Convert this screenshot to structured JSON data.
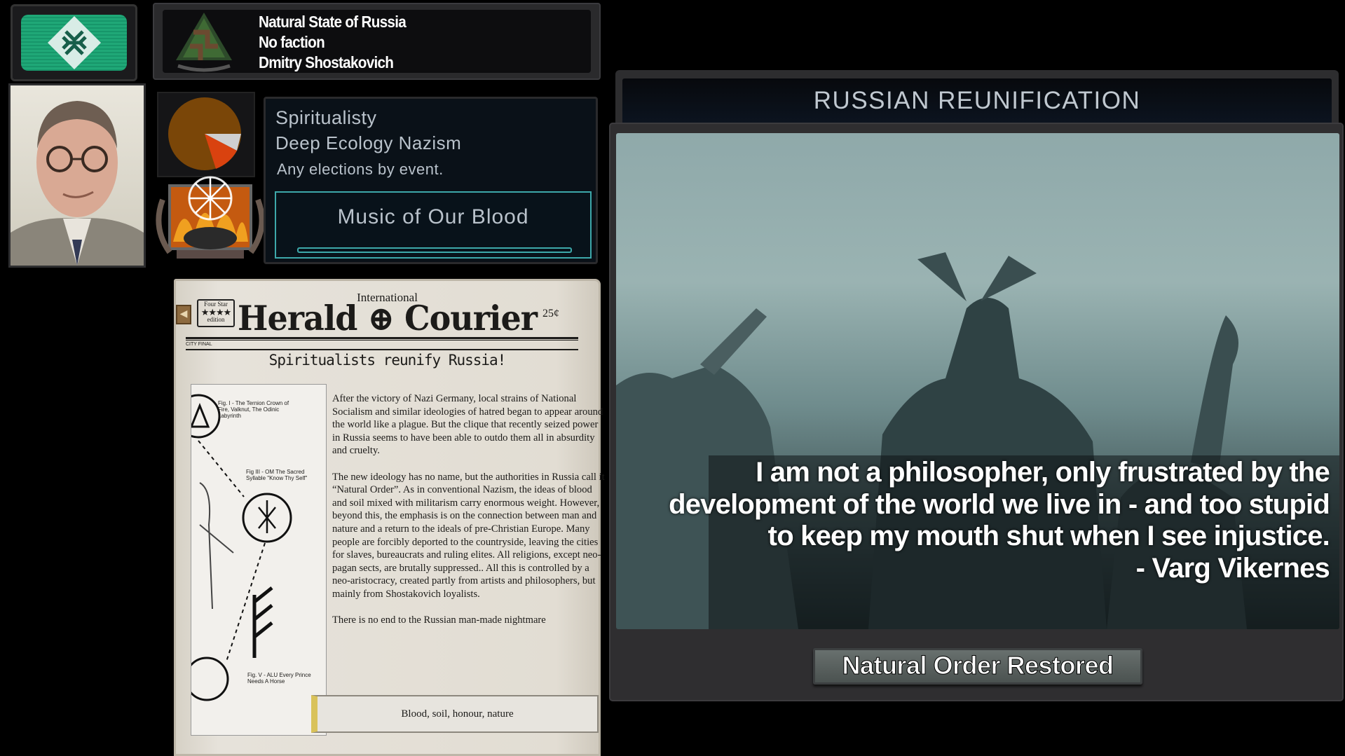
{
  "country": {
    "name": "Natural State of Russia",
    "faction": "No faction",
    "leader": "Dmitry Shostakovich",
    "flag_icon": "rune-diamond-icon",
    "flag_color": "#1fa877"
  },
  "ideology": {
    "party": "Spiritualisty",
    "ideology": "Deep Ecology Nazism",
    "elections": "Any elections by event.",
    "national_spirit": "Music of Our Blood",
    "pie_colors": [
      "#7a4608",
      "#d9420f",
      "#cfcfcf"
    ]
  },
  "newspaper": {
    "edition_badge": {
      "top": "Four Star",
      "stars": "★★★★",
      "bottom": "edition"
    },
    "masthead_small": "International",
    "masthead": "Herald ⊕ Courier",
    "price": "25¢",
    "city_final": "CITY FINAL",
    "headline": "Spiritualists reunify Russia!",
    "figure_captions": [
      "Fig. I - The Ternion Crown of Fire, Valknut, The Odinic Labyrinth",
      "Fig III - OM The Sacred Syllable \"Know Thy Self\"",
      "Fig. V - ALU Every Prince Needs A Horse"
    ],
    "body": "After the victory of Nazi Germany, local strains of National Socialism and similar ideologies of hatred began to appear around the world like a plague. But the clique that recently seized power in Russia seems to have been able to outdo them all in absurdity and cruelty.\n\nThe new ideology has no name, but the authorities in Russia call it “Natural Order”. As in conventional Nazism, the ideas of blood and soil mixed with militarism carry enormous weight. However, beyond this, the emphasis is on the connection between man and nature and a return to the ideals of pre-Christian Europe. Many people are forcibly deported to the countryside, leaving the cities for slaves, bureaucrats and ruling elites. All religions, except neo-pagan sects, are brutally suppressed.. All this is controlled by a neo-aristocracy, created partly from artists and philosophers, but mainly from Shostakovich loyalists.\n\nThere is no end to the Russian man-made nightmare",
    "option": "Blood, soil, honour, nature"
  },
  "event": {
    "title": "RUSSIAN REUNIFICATION",
    "quote": "I am not a philosopher, only frustrated by the\ndevelopment of the world we live in - and too stupid\nto keep my mouth shut when I see injustice.\n- Varg Vikernes",
    "option": "Natural Order Restored"
  }
}
